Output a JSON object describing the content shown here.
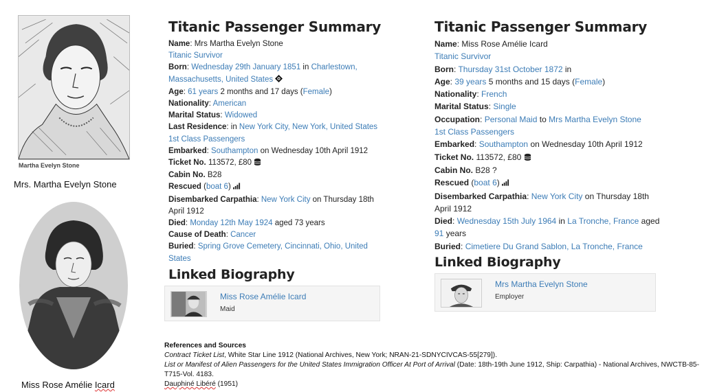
{
  "left_column": {
    "photo1_inscription": "Martha Evelyn Stone",
    "caption1": "Mrs. Martha Evelyn Stone",
    "caption2_prefix": "Miss Rose Amélie ",
    "caption2_surname": "Icard"
  },
  "panel1": {
    "title": "Titanic Passenger Summary",
    "name_label": "Name",
    "name_value": "Mrs Martha Evelyn Stone",
    "survivor": "Titanic Survivor",
    "born_label": "Born",
    "born_date": "Wednesday 29th January 1851",
    "born_in": "in",
    "born_place": "Charlestown, Massachusetts, United States",
    "age_label": "Age",
    "age_years": "61 years",
    "age_rest": "2 months and 17 days (",
    "age_gender": "Female",
    "age_close": ")",
    "nationality_label": "Nationality",
    "nationality": "American",
    "marital_label": "Marital Status",
    "marital": "Widowed",
    "residence_label": "Last Residence",
    "residence_in": "in",
    "residence": "New York City, New York, United States",
    "class": "1st Class Passengers",
    "embarked_label": "Embarked",
    "embarked_port": "Southampton",
    "embarked_rest": "on Wednesday 10th April 1912",
    "ticket_label": "Ticket No.",
    "ticket": "113572, £80",
    "cabin_label": "Cabin No.",
    "cabin": "B28",
    "rescued_label": "Rescued",
    "rescued_open": "(",
    "rescued_boat": "boat 6",
    "rescued_close": ")",
    "disembarked_label": "Disembarked Carpathia",
    "disembarked_city": "New York City",
    "disembarked_rest": "on Thursday 18th April 1912",
    "died_label": "Died",
    "died_date": "Monday 12th May 1924",
    "died_rest": "aged 73 years",
    "cause_label": "Cause of Death",
    "cause": "Cancer",
    "buried_label": "Buried",
    "buried": "Spring Grove Cemetery, Cincinnati, Ohio, United States",
    "linked_title": "Linked Biography",
    "linked_name": "Miss Rose Amélie Icard",
    "linked_role": "Maid"
  },
  "panel2": {
    "title": "Titanic Passenger Summary",
    "name_label": "Name",
    "name_value": "Miss Rose Amélie Icard",
    "survivor": "Titanic Survivor",
    "born_label": "Born",
    "born_date": "Thursday 31st October 1872",
    "born_in": "in",
    "age_label": "Age",
    "age_years": "39 years",
    "age_rest": "5 months and 15 days (",
    "age_gender": "Female",
    "age_close": ")",
    "nationality_label": "Nationality",
    "nationality": "French",
    "marital_label": "Marital Status",
    "marital": "Single",
    "occupation_label": "Occupation",
    "occupation": "Personal Maid",
    "occupation_to": "to",
    "employer": "Mrs Martha Evelyn Stone",
    "class": "1st Class Passengers",
    "embarked_label": "Embarked",
    "embarked_port": "Southampton",
    "embarked_rest": "on Wednesday 10th April 1912",
    "ticket_label": "Ticket No.",
    "ticket": "113572, £80",
    "cabin_label": "Cabin No.",
    "cabin": "B28 ?",
    "rescued_label": "Rescued",
    "rescued_open": "(",
    "rescued_boat": "boat 6",
    "rescued_close": ")",
    "disembarked_label": "Disembarked Carpathia",
    "disembarked_city": "New York City",
    "disembarked_rest": "on Thursday 18th April 1912",
    "died_label": "Died",
    "died_date": "Wednesday 15th July 1964",
    "died_in": "in",
    "died_place": "La Tronche, France",
    "died_aged": "aged",
    "died_age": "91",
    "died_years": "years",
    "buried_label": "Buried",
    "buried": "Cimetiere Du Grand Sablon, La Tronche, France",
    "linked_title": "Linked Biography",
    "linked_name": "Mrs Martha Evelyn Stone",
    "linked_role": "Employer"
  },
  "references": {
    "title": "References and Sources",
    "r1_title": "Contract Ticket List",
    "r1_rest": ", White Star Line 1912 (National Archives, New York; NRAN-21-SDNYCIVCAS-55[279]).",
    "r2_title": "List or Manifest of Alien Passengers for the United States Immigration Officer At Port of Arrival",
    "r2_rest": " (Date: 18th-19th June 1912, Ship: Carpathia) - National Archives, NWCTB-85-T715-Vol. 4183.",
    "r3_name": "Dauphiné Libéré",
    "r3_year": " (1951)"
  },
  "icons": {
    "ticket": "coins-icon",
    "rescued": "signal-bars-icon",
    "born_place": "map-marker-icon"
  }
}
